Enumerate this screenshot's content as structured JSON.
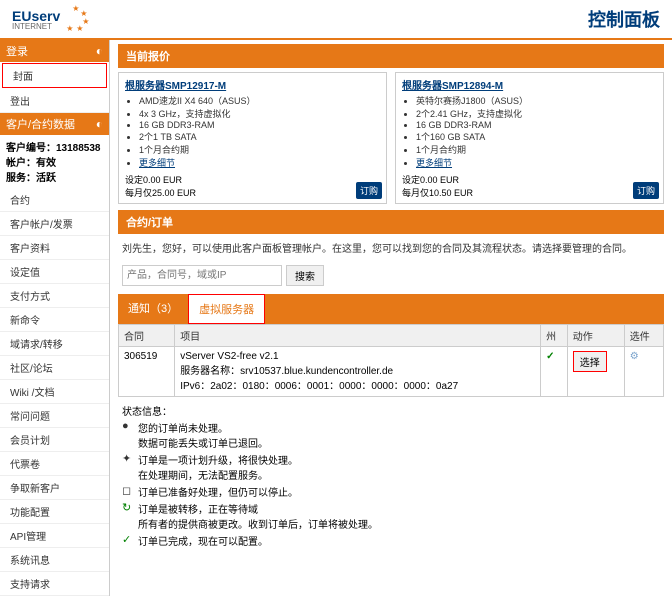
{
  "header": {
    "logo_main": "EUserv",
    "logo_sub": "INTERNET",
    "panel_title": "控制面板"
  },
  "sidebar": {
    "login_header": "登录",
    "login_items": [
      "封面",
      "登出"
    ],
    "data_header": "客户/合约数据",
    "customer_no_label": "客户编号",
    "customer_no": "13188538",
    "account_label": "帐户",
    "account_status": "有效",
    "service_label": "服务",
    "service_status": "活跃",
    "menu": [
      "合约",
      "客户帐户/发票",
      "客户资料",
      "设定值",
      "支付方式",
      "新命令",
      "域请求/转移",
      "社区/论坛",
      "Wiki /文档",
      "常问问题",
      "会员计划",
      "代票卷",
      "争取新客户",
      "功能配置",
      "API管理",
      "系统讯息",
      "支持请求"
    ]
  },
  "offers": {
    "header": "当前报价",
    "items": [
      {
        "title": "根服务器SMP12917-M",
        "specs": [
          "AMD速龙II X4 640（ASUS）",
          "4x 3 GHz，支持虚拟化",
          "16 GB DDR3-RAM",
          "2个1 TB SATA",
          "1个月合约期"
        ],
        "more": "更多细节",
        "setup": "设定0.00 EUR",
        "monthly": "每月仅25.00 EUR",
        "btn": "订购"
      },
      {
        "title": "根服务器SMP12894-M",
        "specs": [
          "英特尔赛扬J1800（ASUS）",
          "2个2.41 GHz，支持虚拟化",
          "16 GB DDR3-RAM",
          "1个160 GB SATA",
          "1个月合约期"
        ],
        "more": "更多细节",
        "setup": "设定0.00 EUR",
        "monthly": "每月仅10.50 EUR",
        "btn": "订购"
      }
    ]
  },
  "contracts": {
    "header": "合约/订单",
    "welcome": "刘先生，您好，可以使用此客户面板管理帐户。在这里，您可以找到您的合同及其流程状态。请选择要管理的合同。",
    "search_placeholder": "产品，合同号，域或IP",
    "search_btn": "搜索",
    "tabs": [
      "通知（3）",
      "虚拟服务器"
    ],
    "table": {
      "headers": [
        "合同",
        "项目",
        "州",
        "动作",
        "选件"
      ],
      "row": {
        "id": "306519",
        "product": "vServer VS2-free v2.1",
        "server": "服务器名称：srv10537.blue.kundencontroller.de",
        "ipv6": "IPv6：2a02：0180：0006：0001：0000：0000：0000：0a27",
        "action": "选择"
      }
    },
    "status_label": "状态信息：",
    "status_lines": [
      {
        "icon": "●",
        "color": "#333",
        "text1": "您的订单尚未处理。",
        "text2": "数据可能丢失或订单已退回。"
      },
      {
        "icon": "✦",
        "color": "#333",
        "text1": "订单是一项计划升级，将很快处理。",
        "text2": "在处理期间，无法配置服务。"
      },
      {
        "icon": "◻",
        "color": "#333",
        "text1": "订单已准备好处理，但仍可以停止。"
      },
      {
        "icon": "↻",
        "color": "green",
        "text1": "订单是被转移，正在等待域",
        "text2": "所有者的提供商被更改。收到订单后，订单将被处理。"
      },
      {
        "icon": "✓",
        "color": "green",
        "text1": "订单已完成，现在可以配置。"
      }
    ]
  }
}
